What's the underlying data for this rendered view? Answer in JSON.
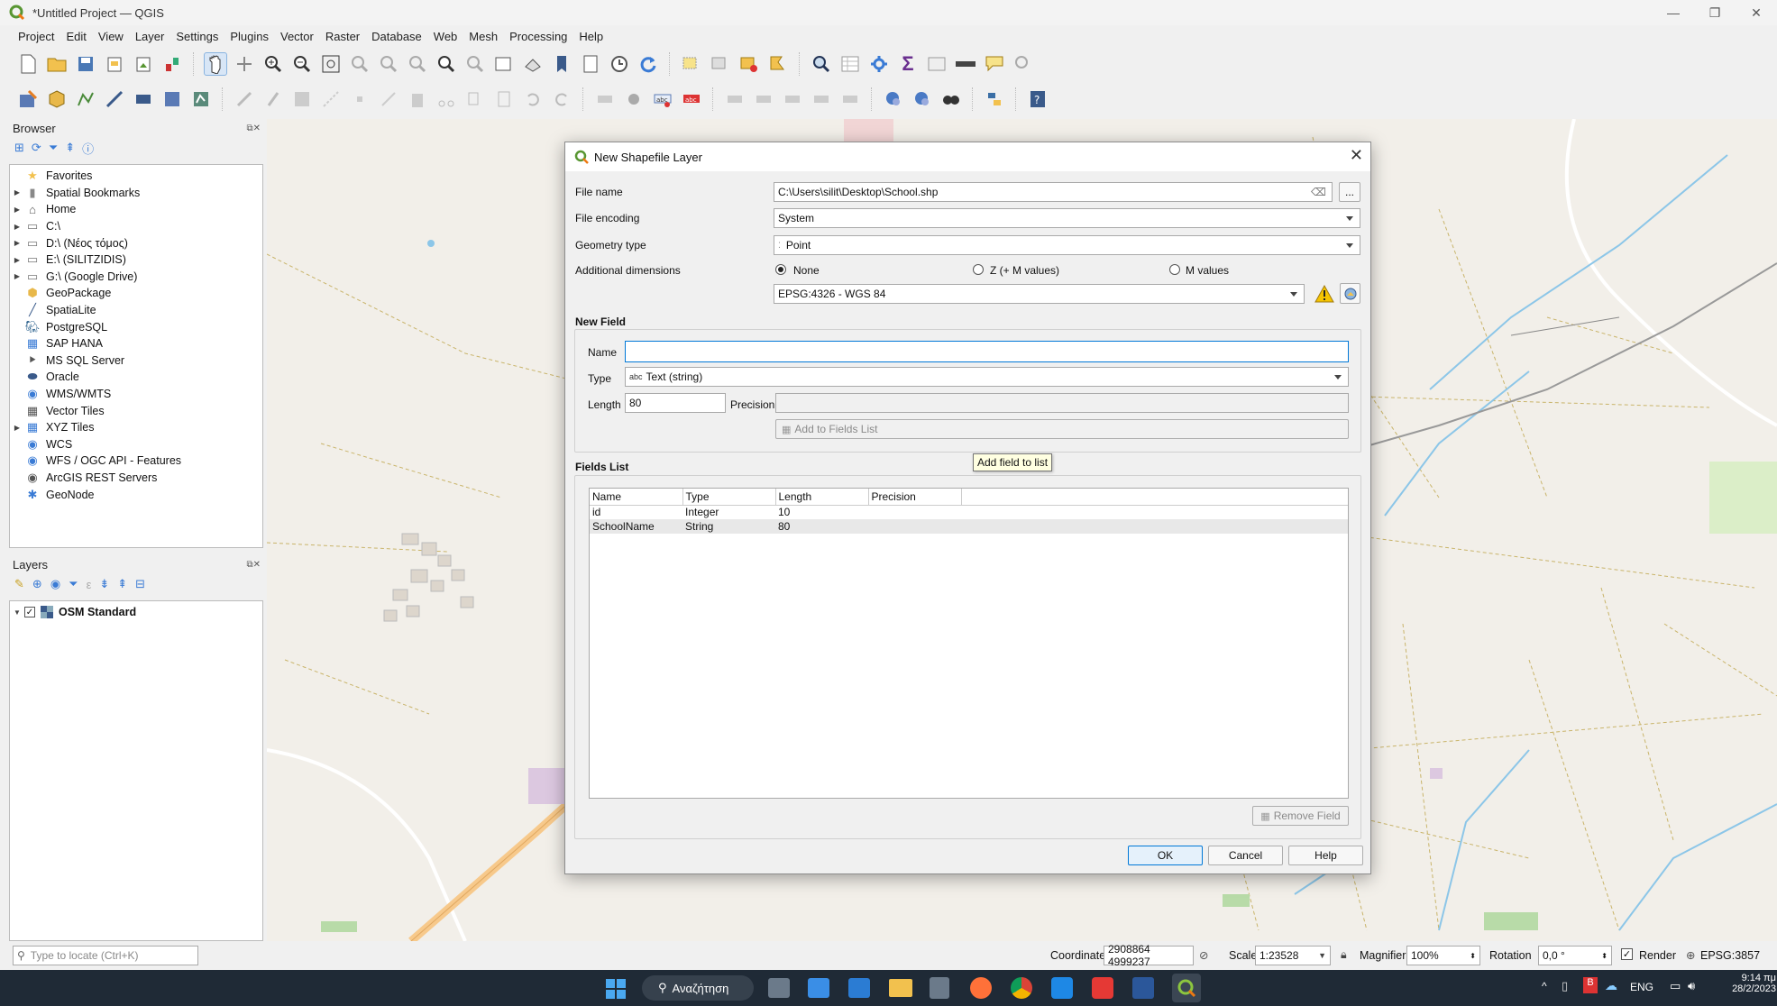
{
  "window": {
    "title": "*Untitled Project — QGIS"
  },
  "menu": [
    "Project",
    "Edit",
    "View",
    "Layer",
    "Settings",
    "Plugins",
    "Vector",
    "Raster",
    "Database",
    "Web",
    "Mesh",
    "Processing",
    "Help"
  ],
  "browser": {
    "title": "Browser",
    "items": [
      {
        "label": "Favorites",
        "icon": "star-icon",
        "expand": false
      },
      {
        "label": "Spatial Bookmarks",
        "icon": "bookmark-icon",
        "expand": true
      },
      {
        "label": "Home",
        "icon": "home-folder-icon",
        "expand": true
      },
      {
        "label": "C:\\",
        "icon": "drive-icon",
        "expand": true
      },
      {
        "label": "D:\\ (Νέος τόμος)",
        "icon": "drive-icon",
        "expand": true
      },
      {
        "label": "E:\\ (SILITZIDIS)",
        "icon": "drive-icon",
        "expand": true
      },
      {
        "label": "G:\\ (Google Drive)",
        "icon": "drive-icon",
        "expand": true
      },
      {
        "label": "GeoPackage",
        "icon": "geopackage-icon",
        "expand": false
      },
      {
        "label": "SpatiaLite",
        "icon": "spatialite-icon",
        "expand": false
      },
      {
        "label": "PostgreSQL",
        "icon": "postgresql-icon",
        "expand": false
      },
      {
        "label": "SAP HANA",
        "icon": "sap-hana-icon",
        "expand": false
      },
      {
        "label": "MS SQL Server",
        "icon": "mssql-icon",
        "expand": false
      },
      {
        "label": "Oracle",
        "icon": "oracle-icon",
        "expand": false
      },
      {
        "label": "WMS/WMTS",
        "icon": "wms-icon",
        "expand": false
      },
      {
        "label": "Vector Tiles",
        "icon": "vector-tiles-icon",
        "expand": false
      },
      {
        "label": "XYZ Tiles",
        "icon": "xyz-tiles-icon",
        "expand": true
      },
      {
        "label": "WCS",
        "icon": "wcs-icon",
        "expand": false
      },
      {
        "label": "WFS / OGC API - Features",
        "icon": "wfs-icon",
        "expand": false
      },
      {
        "label": "ArcGIS REST Servers",
        "icon": "arcgis-icon",
        "expand": false
      },
      {
        "label": "GeoNode",
        "icon": "geonode-icon",
        "expand": false
      }
    ]
  },
  "layers": {
    "title": "Layers",
    "items": [
      {
        "label": "OSM Standard",
        "checked": true
      }
    ]
  },
  "dialog": {
    "title": "New Shapefile Layer",
    "file_name_label": "File name",
    "file_name_value": "C:\\Users\\silit\\Desktop\\School.shp",
    "browse_label": "...",
    "file_encoding_label": "File encoding",
    "file_encoding_value": "System",
    "geometry_type_label": "Geometry type",
    "geometry_type_value": "Point",
    "additional_dimensions_label": "Additional dimensions",
    "dim_none": "None",
    "dim_zm": "Z (+ M values)",
    "dim_m": "M values",
    "crs_value": "EPSG:4326 - WGS 84",
    "new_field": {
      "title": "New Field",
      "name_label": "Name",
      "name_value": "",
      "type_label": "Type",
      "type_prefix": "abc",
      "type_value": "Text (string)",
      "length_label": "Length",
      "length_value": "80",
      "precision_label": "Precision",
      "precision_value": "",
      "add_button": "Add to Fields List",
      "tooltip": "Add field to list"
    },
    "fields_list": {
      "title": "Fields List",
      "columns": [
        "Name",
        "Type",
        "Length",
        "Precision"
      ],
      "rows": [
        {
          "name": "id",
          "type": "Integer",
          "length": "10",
          "precision": ""
        },
        {
          "name": "SchoolName",
          "type": "String",
          "length": "80",
          "precision": ""
        }
      ],
      "remove_button": "Remove Field"
    },
    "ok": "OK",
    "cancel": "Cancel",
    "help": "Help"
  },
  "statusbar": {
    "locate_placeholder": "Type to locate (Ctrl+K)",
    "coordinate_label": "Coordinate",
    "coordinate_value": "2908864 4999237",
    "scale_label": "Scale",
    "scale_value": "1:23528",
    "magnifier_label": "Magnifier",
    "magnifier_value": "100%",
    "rotation_label": "Rotation",
    "rotation_value": "0,0 °",
    "render_label": "Render",
    "crs_label": "EPSG:3857"
  },
  "taskbar": {
    "search_label": "Αναζήτηση",
    "lang": "ENG",
    "time": "9:14 πμ",
    "date": "28/2/2023"
  },
  "colors": {
    "qgis_green": "#589632",
    "accent_blue": "#0078d7",
    "map_bg": "#f2efe9",
    "taskbar": "#1f2a36"
  }
}
